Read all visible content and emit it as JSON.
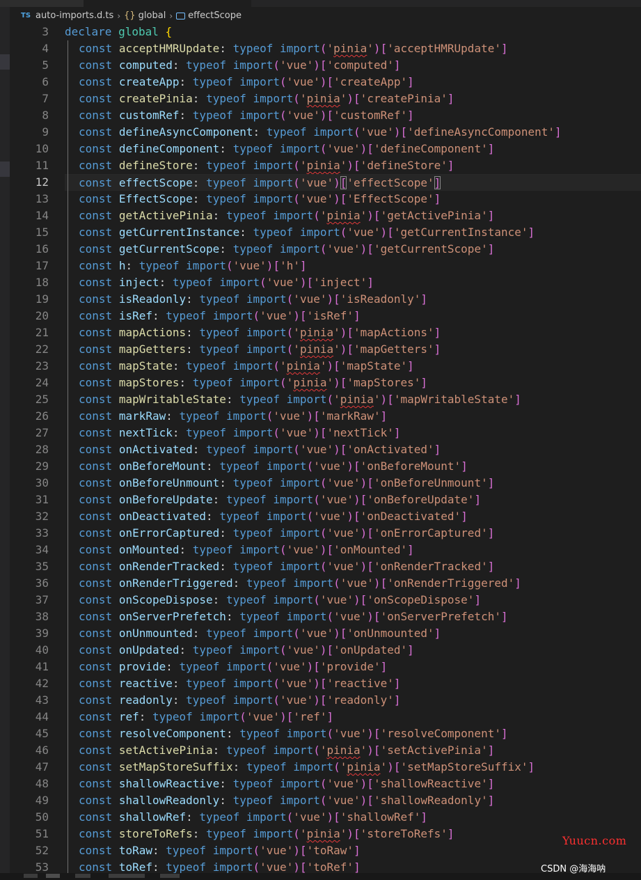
{
  "breadcrumb": {
    "lang_badge": "TS",
    "file": "auto-imports.d.ts",
    "braces": "{}",
    "namespace": "global",
    "symbol": "effectScope"
  },
  "editor": {
    "active_line": 12,
    "header": {
      "line": 3,
      "kw": "declare",
      "name": "global",
      "brace": "{"
    },
    "imports": [
      {
        "line": 4,
        "name": "acceptHMRUpdate",
        "pkg": "pinia"
      },
      {
        "line": 5,
        "name": "computed",
        "pkg": "vue"
      },
      {
        "line": 6,
        "name": "createApp",
        "pkg": "vue"
      },
      {
        "line": 7,
        "name": "createPinia",
        "pkg": "pinia"
      },
      {
        "line": 8,
        "name": "customRef",
        "pkg": "vue"
      },
      {
        "line": 9,
        "name": "defineAsyncComponent",
        "pkg": "vue"
      },
      {
        "line": 10,
        "name": "defineComponent",
        "pkg": "vue"
      },
      {
        "line": 11,
        "name": "defineStore",
        "pkg": "pinia"
      },
      {
        "line": 12,
        "name": "effectScope",
        "pkg": "vue"
      },
      {
        "line": 13,
        "name": "EffectScope",
        "pkg": "vue"
      },
      {
        "line": 14,
        "name": "getActivePinia",
        "pkg": "pinia"
      },
      {
        "line": 15,
        "name": "getCurrentInstance",
        "pkg": "vue"
      },
      {
        "line": 16,
        "name": "getCurrentScope",
        "pkg": "vue"
      },
      {
        "line": 17,
        "name": "h",
        "pkg": "vue"
      },
      {
        "line": 18,
        "name": "inject",
        "pkg": "vue"
      },
      {
        "line": 19,
        "name": "isReadonly",
        "pkg": "vue"
      },
      {
        "line": 20,
        "name": "isRef",
        "pkg": "vue"
      },
      {
        "line": 21,
        "name": "mapActions",
        "pkg": "pinia"
      },
      {
        "line": 22,
        "name": "mapGetters",
        "pkg": "pinia"
      },
      {
        "line": 23,
        "name": "mapState",
        "pkg": "pinia"
      },
      {
        "line": 24,
        "name": "mapStores",
        "pkg": "pinia"
      },
      {
        "line": 25,
        "name": "mapWritableState",
        "pkg": "pinia"
      },
      {
        "line": 26,
        "name": "markRaw",
        "pkg": "vue"
      },
      {
        "line": 27,
        "name": "nextTick",
        "pkg": "vue"
      },
      {
        "line": 28,
        "name": "onActivated",
        "pkg": "vue"
      },
      {
        "line": 29,
        "name": "onBeforeMount",
        "pkg": "vue"
      },
      {
        "line": 30,
        "name": "onBeforeUnmount",
        "pkg": "vue"
      },
      {
        "line": 31,
        "name": "onBeforeUpdate",
        "pkg": "vue"
      },
      {
        "line": 32,
        "name": "onDeactivated",
        "pkg": "vue"
      },
      {
        "line": 33,
        "name": "onErrorCaptured",
        "pkg": "vue"
      },
      {
        "line": 34,
        "name": "onMounted",
        "pkg": "vue"
      },
      {
        "line": 35,
        "name": "onRenderTracked",
        "pkg": "vue"
      },
      {
        "line": 36,
        "name": "onRenderTriggered",
        "pkg": "vue"
      },
      {
        "line": 37,
        "name": "onScopeDispose",
        "pkg": "vue"
      },
      {
        "line": 38,
        "name": "onServerPrefetch",
        "pkg": "vue"
      },
      {
        "line": 39,
        "name": "onUnmounted",
        "pkg": "vue"
      },
      {
        "line": 40,
        "name": "onUpdated",
        "pkg": "vue"
      },
      {
        "line": 41,
        "name": "provide",
        "pkg": "vue"
      },
      {
        "line": 42,
        "name": "reactive",
        "pkg": "vue"
      },
      {
        "line": 43,
        "name": "readonly",
        "pkg": "vue"
      },
      {
        "line": 44,
        "name": "ref",
        "pkg": "vue"
      },
      {
        "line": 45,
        "name": "resolveComponent",
        "pkg": "vue"
      },
      {
        "line": 46,
        "name": "setActivePinia",
        "pkg": "pinia"
      },
      {
        "line": 47,
        "name": "setMapStoreSuffix",
        "pkg": "pinia"
      },
      {
        "line": 48,
        "name": "shallowReactive",
        "pkg": "vue"
      },
      {
        "line": 49,
        "name": "shallowReadonly",
        "pkg": "vue"
      },
      {
        "line": 50,
        "name": "shallowRef",
        "pkg": "vue"
      },
      {
        "line": 51,
        "name": "storeToRefs",
        "pkg": "pinia"
      },
      {
        "line": 52,
        "name": "toRaw",
        "pkg": "vue"
      },
      {
        "line": 53,
        "name": "toRef",
        "pkg": "vue"
      }
    ]
  },
  "watermarks": {
    "site": "Yuucn.com",
    "author": "CSDN @海海呐"
  }
}
